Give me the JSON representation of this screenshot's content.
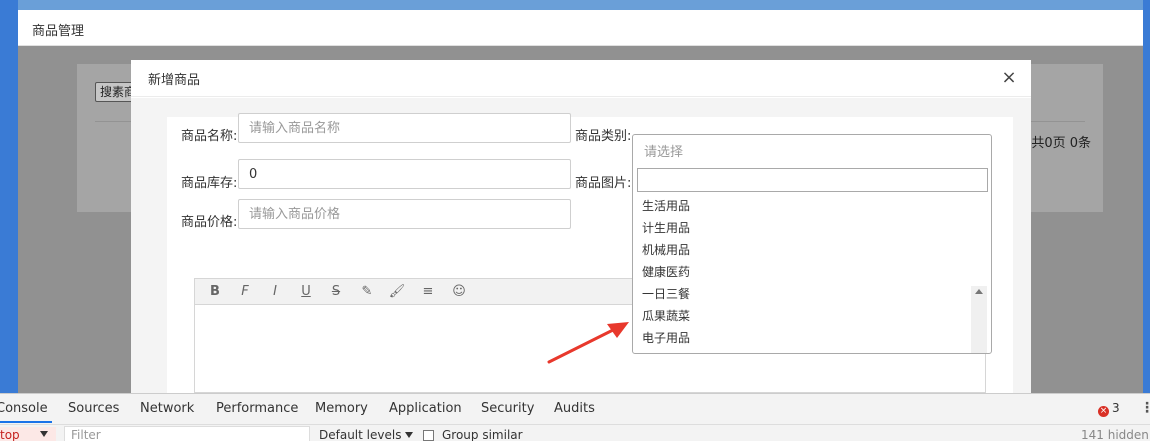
{
  "page": {
    "title": "商品管理",
    "search_button": "搜素商品",
    "pager_text": "共0页 0条"
  },
  "modal": {
    "title": "新增商品",
    "close_icon": "×",
    "form": {
      "name_label": "商品名称:",
      "name_placeholder": "请输入商品名称",
      "category_label": "商品类别:",
      "category_placeholder": "请选择",
      "stock_label": "商品库存:",
      "stock_value": "0",
      "image_label": "商品图片:",
      "price_label": "商品价格:",
      "price_placeholder": "请输入商品价格"
    },
    "editor_tools": [
      {
        "name": "bold-icon",
        "glyph": "B"
      },
      {
        "name": "font-icon",
        "glyph": "F"
      },
      {
        "name": "italic-icon",
        "glyph": "I"
      },
      {
        "name": "underline-icon",
        "glyph": "U"
      },
      {
        "name": "strikethrough-icon",
        "glyph": "S"
      },
      {
        "name": "link-icon",
        "glyph": "✎"
      },
      {
        "name": "brush-icon",
        "glyph": "🖌"
      },
      {
        "name": "align-icon",
        "glyph": "≡"
      },
      {
        "name": "emoji-icon",
        "glyph": "☺"
      }
    ],
    "category_options": [
      "生活用品",
      "计生用品",
      "机械用品",
      "健康医药",
      "一日三餐",
      "瓜果蔬菜",
      "电子用品"
    ]
  },
  "devtools": {
    "tabs": [
      "Console",
      "Sources",
      "Network",
      "Performance",
      "Memory",
      "Application",
      "Security",
      "Audits"
    ],
    "active_tab": "Console",
    "error_count": "3",
    "error_icon": "×",
    "more_icon": "⋮",
    "context_value": "top",
    "filter_placeholder": "Filter",
    "levels_label": "Default levels",
    "group_similar_label": "Group similar",
    "hidden_label": "141 hidden"
  },
  "colors": {
    "accent_blue": "#3a7bd5",
    "error_red": "#d93025",
    "annotation_arrow": "#e8382c"
  }
}
